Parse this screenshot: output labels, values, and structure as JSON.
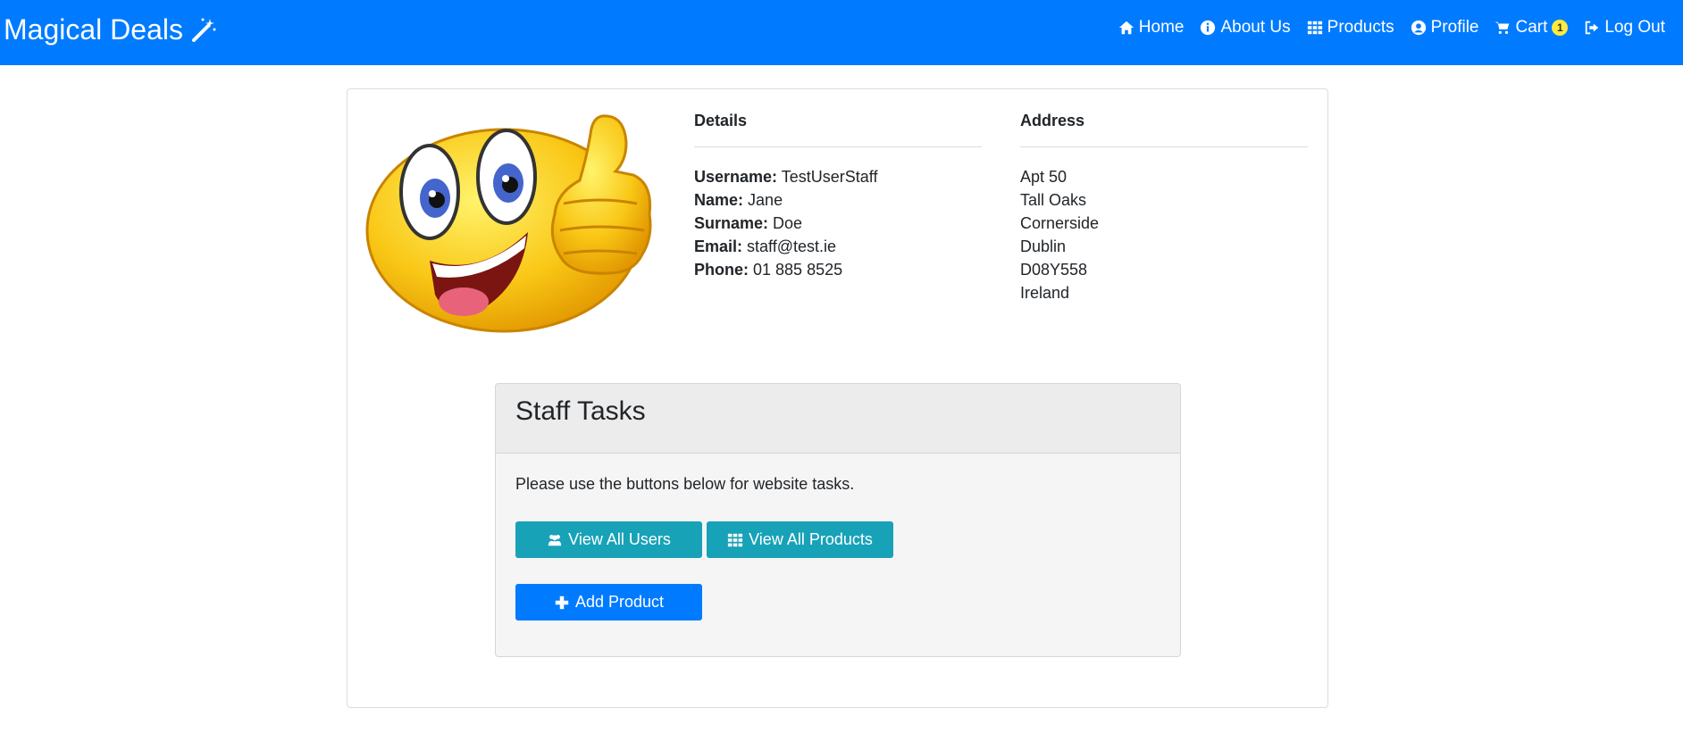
{
  "nav": {
    "brand": "Magical Deals",
    "items": [
      {
        "label": "Home",
        "icon": "home-icon"
      },
      {
        "label": "About Us",
        "icon": "info-icon"
      },
      {
        "label": "Products",
        "icon": "grid-icon"
      },
      {
        "label": "Profile",
        "icon": "user-circle-icon"
      },
      {
        "label": "Cart",
        "icon": "cart-icon",
        "badge": "1"
      },
      {
        "label": "Log Out",
        "icon": "logout-icon"
      }
    ]
  },
  "details": {
    "heading": "Details",
    "username_label": "Username:",
    "username": "TestUserStaff",
    "name_label": "Name:",
    "name": "Jane",
    "surname_label": "Surname:",
    "surname": "Doe",
    "email_label": "Email:",
    "email": "staff@test.ie",
    "phone_label": "Phone:",
    "phone": "01 885 8525"
  },
  "address": {
    "heading": "Address",
    "lines": [
      "Apt 50",
      "Tall Oaks",
      "Cornerside",
      "Dublin",
      "D08Y558",
      "Ireland"
    ]
  },
  "staff": {
    "title": "Staff Tasks",
    "description": "Please use the buttons below for website tasks.",
    "view_users": "View All Users",
    "view_products": "View All Products",
    "add_product": "Add Product"
  },
  "colors": {
    "primary": "#007bff",
    "info": "#17a2b8",
    "badge": "#ffeb3b"
  }
}
